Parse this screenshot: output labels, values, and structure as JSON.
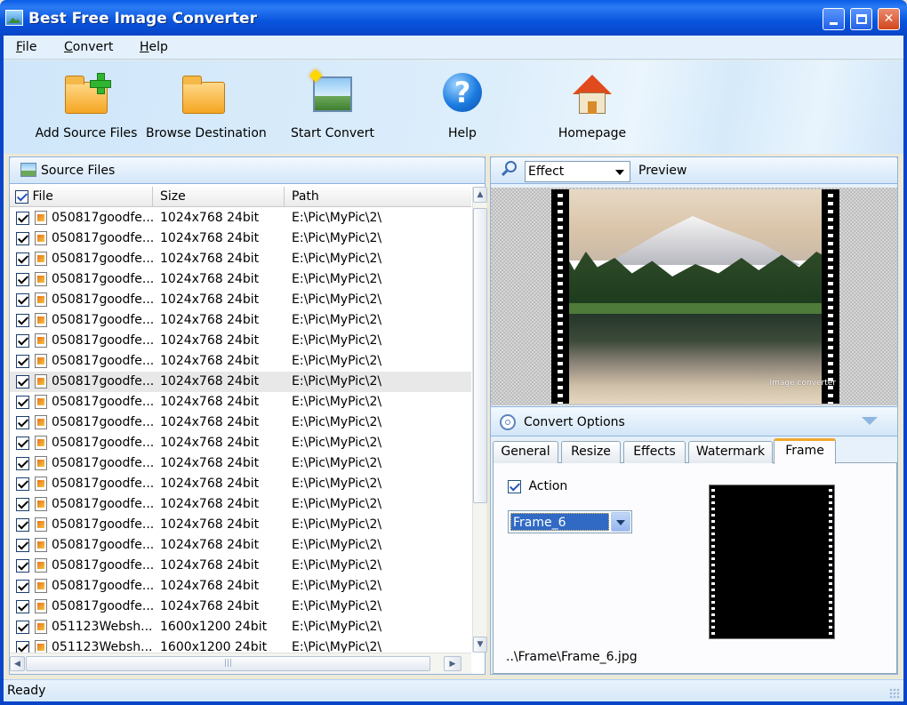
{
  "window": {
    "title": "Best Free Image Converter",
    "app_icon": "landscape-picture-icon",
    "controls": [
      "minimize",
      "maximize",
      "close"
    ]
  },
  "menu": [
    {
      "label": "File"
    },
    {
      "label": "Convert"
    },
    {
      "label": "Help"
    }
  ],
  "toolbar": {
    "add_source": {
      "label": "Add Source Files",
      "icon": "folder-add-icon"
    },
    "browse_destination": {
      "label": "Browse Destination",
      "icon": "folder-icon"
    },
    "start_convert": {
      "label": "Start Convert",
      "icon": "magic-picture-icon"
    },
    "help": {
      "label": "Help",
      "icon": "help-icon"
    },
    "homepage": {
      "label": "Homepage",
      "icon": "home-icon"
    }
  },
  "source_panel": {
    "title": "Source Files",
    "columns": {
      "file": "File",
      "size": "Size",
      "path": "Path"
    },
    "rows": [
      {
        "file": "050817goodfe...",
        "size": "1024x768  24bit",
        "path": "E:\\Pic\\MyPic\\2\\"
      },
      {
        "file": "050817goodfe...",
        "size": "1024x768  24bit",
        "path": "E:\\Pic\\MyPic\\2\\"
      },
      {
        "file": "050817goodfe...",
        "size": "1024x768  24bit",
        "path": "E:\\Pic\\MyPic\\2\\"
      },
      {
        "file": "050817goodfe...",
        "size": "1024x768  24bit",
        "path": "E:\\Pic\\MyPic\\2\\"
      },
      {
        "file": "050817goodfe...",
        "size": "1024x768  24bit",
        "path": "E:\\Pic\\MyPic\\2\\"
      },
      {
        "file": "050817goodfe...",
        "size": "1024x768  24bit",
        "path": "E:\\Pic\\MyPic\\2\\"
      },
      {
        "file": "050817goodfe...",
        "size": "1024x768  24bit",
        "path": "E:\\Pic\\MyPic\\2\\"
      },
      {
        "file": "050817goodfe...",
        "size": "1024x768  24bit",
        "path": "E:\\Pic\\MyPic\\2\\"
      },
      {
        "file": "050817goodfe...",
        "size": "1024x768  24bit",
        "path": "E:\\Pic\\MyPic\\2\\",
        "selected": true
      },
      {
        "file": "050817goodfe...",
        "size": "1024x768  24bit",
        "path": "E:\\Pic\\MyPic\\2\\"
      },
      {
        "file": "050817goodfe...",
        "size": "1024x768  24bit",
        "path": "E:\\Pic\\MyPic\\2\\"
      },
      {
        "file": "050817goodfe...",
        "size": "1024x768  24bit",
        "path": "E:\\Pic\\MyPic\\2\\"
      },
      {
        "file": "050817goodfe...",
        "size": "1024x768  24bit",
        "path": "E:\\Pic\\MyPic\\2\\"
      },
      {
        "file": "050817goodfe...",
        "size": "1024x768  24bit",
        "path": "E:\\Pic\\MyPic\\2\\"
      },
      {
        "file": "050817goodfe...",
        "size": "1024x768  24bit",
        "path": "E:\\Pic\\MyPic\\2\\"
      },
      {
        "file": "050817goodfe...",
        "size": "1024x768  24bit",
        "path": "E:\\Pic\\MyPic\\2\\"
      },
      {
        "file": "050817goodfe...",
        "size": "1024x768  24bit",
        "path": "E:\\Pic\\MyPic\\2\\"
      },
      {
        "file": "050817goodfe...",
        "size": "1024x768  24bit",
        "path": "E:\\Pic\\MyPic\\2\\"
      },
      {
        "file": "050817goodfe...",
        "size": "1024x768  24bit",
        "path": "E:\\Pic\\MyPic\\2\\"
      },
      {
        "file": "050817goodfe...",
        "size": "1024x768  24bit",
        "path": "E:\\Pic\\MyPic\\2\\"
      },
      {
        "file": "051123Websh...",
        "size": "1600x1200  24bit",
        "path": "E:\\Pic\\MyPic\\2\\"
      },
      {
        "file": "051123Websh...",
        "size": "1600x1200  24bit",
        "path": "E:\\Pic\\MyPic\\2\\"
      }
    ]
  },
  "preview_panel": {
    "effect_select": "Effect",
    "label": "Preview",
    "watermark_text": "Image converter"
  },
  "convert_options": {
    "title": "Convert Options",
    "tabs": [
      "General",
      "Resize",
      "Effects",
      "Watermark",
      "Frame"
    ],
    "active_tab": "Frame",
    "frame": {
      "action_label": "Action",
      "action_checked": true,
      "frame_select": "Frame_6",
      "frame_path": "..\\Frame\\Frame_6.jpg"
    }
  },
  "status": {
    "text": "Ready"
  },
  "colors": {
    "titlebar": "#0A5DE6",
    "accent": "#316AC5",
    "tab_highlight": "#F0A82F"
  }
}
